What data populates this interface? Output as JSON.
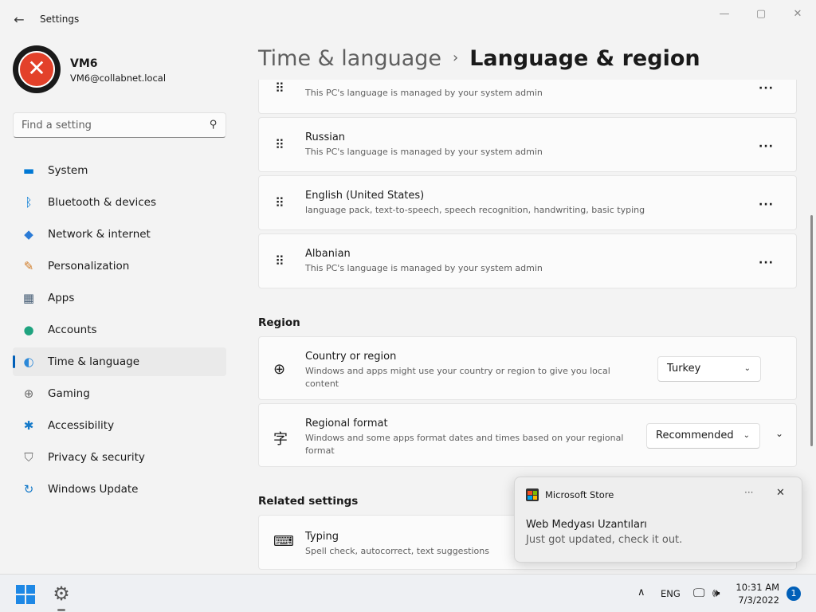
{
  "window": {
    "back_glyph": "←",
    "title": "Settings",
    "minimize_glyph": "—",
    "maximize_glyph": "▢",
    "close_glyph": "✕"
  },
  "user": {
    "avatar_glyph": "✕",
    "name": "VM6",
    "email": "VM6@collabnet.local"
  },
  "search": {
    "placeholder": "Find a setting",
    "icon": "search-icon",
    "icon_glyph": "⚲"
  },
  "sidebar": {
    "items": [
      {
        "label": "System",
        "icon": "system-icon",
        "glyph": "▬",
        "color": "#0078d4"
      },
      {
        "label": "Bluetooth & devices",
        "icon": "bluetooth-icon",
        "glyph": "ᛒ",
        "color": "#0078d4"
      },
      {
        "label": "Network & internet",
        "icon": "wifi-icon",
        "glyph": "◆",
        "color": "#2b7bd6"
      },
      {
        "label": "Personalization",
        "icon": "brush-icon",
        "glyph": "✎",
        "color": "#d07a24"
      },
      {
        "label": "Apps",
        "icon": "apps-icon",
        "glyph": "▦",
        "color": "#4a6178"
      },
      {
        "label": "Accounts",
        "icon": "accounts-icon",
        "glyph": "●",
        "color": "#1fa37f"
      },
      {
        "label": "Time & language",
        "icon": "globe-clock-icon",
        "glyph": "◐",
        "color": "#2b88d8"
      },
      {
        "label": "Gaming",
        "icon": "gamepad-icon",
        "glyph": "⊕",
        "color": "#6b6b6b"
      },
      {
        "label": "Accessibility",
        "icon": "accessibility-icon",
        "glyph": "✱",
        "color": "#1479c9"
      },
      {
        "label": "Privacy & security",
        "icon": "shield-icon",
        "glyph": "⛉",
        "color": "#6b6b6b"
      },
      {
        "label": "Windows Update",
        "icon": "update-icon",
        "glyph": "↻",
        "color": "#1479c9"
      }
    ],
    "active_index": 6
  },
  "breadcrumb": {
    "parent": "Time & language",
    "separator": "›",
    "current": "Language & region"
  },
  "languages": [
    {
      "title": "",
      "subtitle": "This PC's language is managed by your system admin"
    },
    {
      "title": "Russian",
      "subtitle": "This PC's language is managed by your system admin"
    },
    {
      "title": "English (United States)",
      "subtitle": "language pack, text-to-speech, speech recognition, handwriting, basic typing"
    },
    {
      "title": "Albanian",
      "subtitle": "This PC's language is managed by your system admin"
    }
  ],
  "grip_glyph": "⠿",
  "more_glyph": "···",
  "region": {
    "heading": "Region",
    "country": {
      "icon": "globe-icon",
      "glyph": "⊕",
      "title": "Country or region",
      "subtitle": "Windows and apps might use your country or region to give you local content",
      "value": "Turkey"
    },
    "format": {
      "icon": "regional-format-icon",
      "glyph": "字",
      "title": "Regional format",
      "subtitle": "Windows and some apps format dates and times based on your regional format",
      "value": "Recommended"
    },
    "chevron_glyph": "⌄"
  },
  "related": {
    "heading": "Related settings",
    "typing": {
      "icon": "keyboard-icon",
      "glyph": "⌨",
      "title": "Typing",
      "subtitle": "Spell check, autocorrect, text suggestions"
    }
  },
  "toast": {
    "app_name": "Microsoft Store",
    "more_glyph": "···",
    "close_glyph": "✕",
    "title": "Web Medyası Uzantıları",
    "body": "Just got updated, check it out."
  },
  "taskbar": {
    "settings_glyph": "⚙",
    "tray_chevron": "∧",
    "language": "ENG",
    "network_glyph": "🖵",
    "volume_glyph": "🕪",
    "time": "10:31 AM",
    "date": "7/3/2022",
    "notification_count": "1"
  },
  "colors": {
    "accent": "#005fb8",
    "start": "#1e88e5"
  }
}
